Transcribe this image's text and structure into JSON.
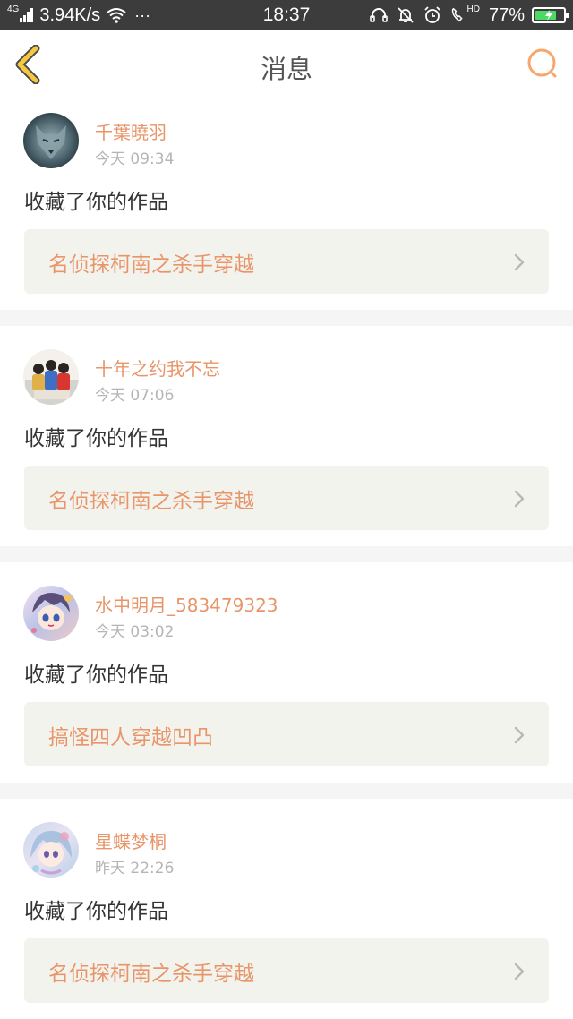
{
  "status_bar": {
    "network": "4G",
    "speed": "3.94K/s",
    "more": "···",
    "time": "18:37",
    "hd": "HD",
    "battery_percent": "77%",
    "battery_level": 0.77,
    "battery_color": "#4cd964",
    "icons": [
      "signal-icon",
      "wifi-icon",
      "headset-icon",
      "bell-off-icon",
      "alarm-icon",
      "hd-call-icon",
      "battery-icon"
    ]
  },
  "header": {
    "title": "消息",
    "back_icon": "chevron-left-icon",
    "search_icon": "search-icon"
  },
  "colors": {
    "accent": "#e8956a",
    "back_arrow": "#f5c842",
    "search": "#f7a76b",
    "work_box_bg": "#f3f3ee",
    "page_bg": "#f5f5f5"
  },
  "messages": [
    {
      "username": "千葉曉羽",
      "time": "今天 09:34",
      "action": "收藏了你的作品",
      "work": "名侦探柯南之杀手穿越",
      "avatar": "wolf-avatar"
    },
    {
      "username": "十年之约我不忘",
      "time": "今天 07:06",
      "action": "收藏了你的作品",
      "work": "名侦探柯南之杀手穿越",
      "avatar": "group-avatar"
    },
    {
      "username": "水中明月_583479323",
      "time": "今天 03:02",
      "action": "收藏了你的作品",
      "work": "搞怪四人穿越凹凸",
      "avatar": "anime-avatar"
    },
    {
      "username": "星蝶梦桐",
      "time": "昨天 22:26",
      "action": "收藏了你的作品",
      "work": "名侦探柯南之杀手穿越",
      "avatar": "anime-avatar"
    }
  ]
}
